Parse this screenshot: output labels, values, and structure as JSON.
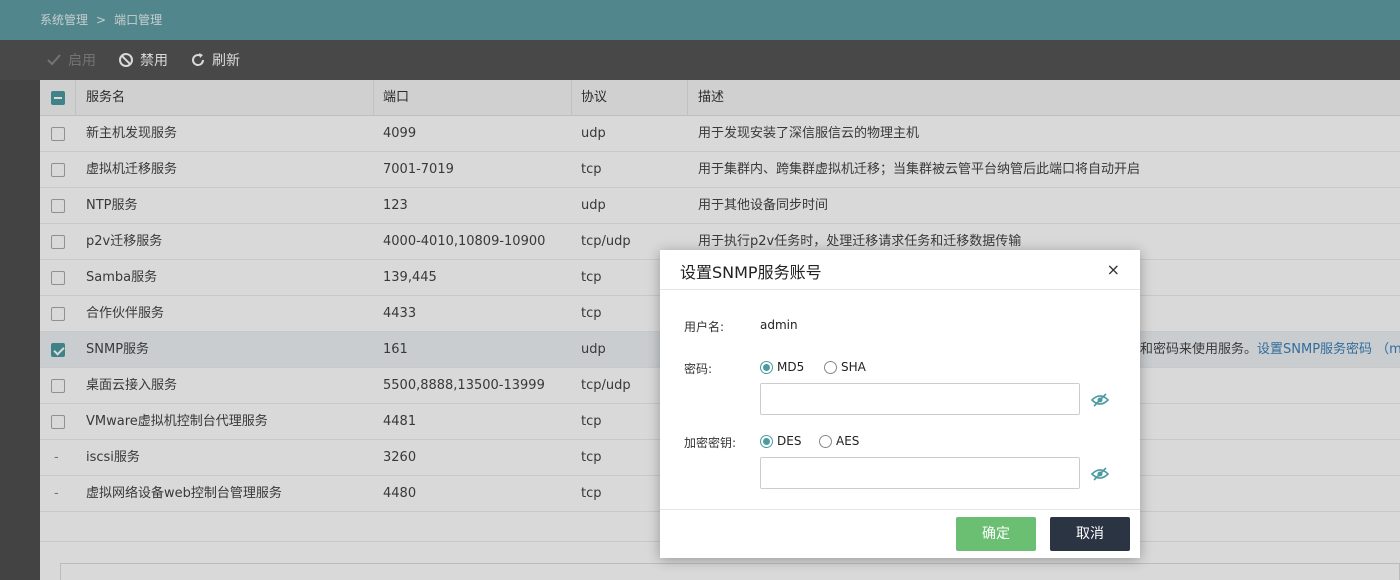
{
  "breadcrumb": {
    "parent": "系统管理",
    "separator": ">",
    "current": "端口管理"
  },
  "toolbar": {
    "enable_label": "启用",
    "disable_label": "禁用",
    "refresh_label": "刷新"
  },
  "table": {
    "headers": {
      "name": "服务名",
      "port": "端口",
      "protocol": "协议",
      "description": "描述"
    },
    "rows": [
      {
        "mark": "checkbox",
        "checked": false,
        "name": "新主机发现服务",
        "port": "4099",
        "protocol": "udp",
        "desc": "用于发现安装了深信服信云的物理主机"
      },
      {
        "mark": "checkbox",
        "checked": false,
        "name": "虚拟机迁移服务",
        "port": "7001-7019",
        "protocol": "tcp",
        "desc": "用于集群内、跨集群虚拟机迁移；当集群被云管平台纳管后此端口将自动开启"
      },
      {
        "mark": "checkbox",
        "checked": false,
        "name": "NTP服务",
        "port": "123",
        "protocol": "udp",
        "desc": "用于其他设备同步时间"
      },
      {
        "mark": "checkbox",
        "checked": false,
        "name": "p2v迁移服务",
        "port": "4000-4010,10809-10900",
        "protocol": "tcp/udp",
        "desc": "用于执行p2v任务时，处理迁移请求任务和迁移数据传输"
      },
      {
        "mark": "checkbox",
        "checked": false,
        "name": "Samba服务",
        "port": "139,445",
        "protocol": "tcp",
        "desc": ""
      },
      {
        "mark": "checkbox",
        "checked": false,
        "name": "合作伙伴服务",
        "port": "4433",
        "protocol": "tcp",
        "desc": ""
      },
      {
        "mark": "checkbox",
        "checked": true,
        "name": "SNMP服务",
        "port": "161",
        "protocol": "udp",
        "desc": "和密码来使用服务。",
        "link": "设置SNMP服务密码 （mib库"
      },
      {
        "mark": "checkbox",
        "checked": false,
        "name": "桌面云接入服务",
        "port": "5500,8888,13500-13999",
        "protocol": "tcp/udp",
        "desc": ""
      },
      {
        "mark": "checkbox",
        "checked": false,
        "name": "VMware虚拟机控制台代理服务",
        "port": "4481",
        "protocol": "tcp",
        "desc": ""
      },
      {
        "mark": "dash",
        "dash": "-",
        "name": "iscsi服务",
        "port": "3260",
        "protocol": "tcp",
        "desc": ""
      },
      {
        "mark": "dash",
        "dash": "-",
        "name": "虚拟网络设备web控制台管理服务",
        "port": "4480",
        "protocol": "tcp",
        "desc": ""
      }
    ]
  },
  "modal": {
    "title": "设置SNMP服务账号",
    "close_symbol": "×",
    "username_label": "用户名:",
    "username_value": "admin",
    "password_label": "密码:",
    "password_algorithms": [
      {
        "label": "MD5",
        "selected": true
      },
      {
        "label": "SHA",
        "selected": false
      }
    ],
    "password_value": "",
    "encryption_label": "加密密钥:",
    "encryption_algorithms": [
      {
        "label": "DES",
        "selected": true
      },
      {
        "label": "AES",
        "selected": false
      }
    ],
    "encryption_value": "",
    "confirm_label": "确定",
    "cancel_label": "取消"
  },
  "colors": {
    "topbar": "#5f9ea5",
    "toolbar": "#555555",
    "accent": "#4b9ba1",
    "confirm": "#6bbf73",
    "cancel": "#2a3443",
    "link": "#3a7fb8"
  },
  "icons": {
    "enable": "check-icon",
    "disable": "ban-icon",
    "refresh": "refresh-icon",
    "eye": "eye-slash-icon"
  }
}
